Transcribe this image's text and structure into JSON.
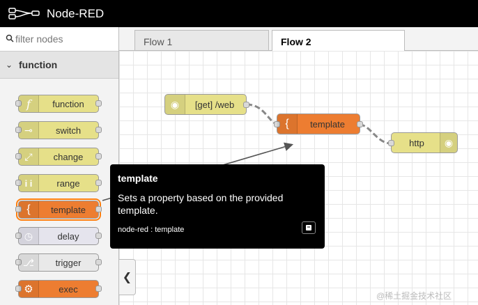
{
  "app": {
    "title": "Node-RED"
  },
  "palette": {
    "filter_placeholder": "filter nodes",
    "category": "function",
    "nodes": [
      {
        "label": "function",
        "icon": "function-icon",
        "color": "#e6e089"
      },
      {
        "label": "switch",
        "icon": "switch-icon",
        "color": "#e6e089"
      },
      {
        "label": "change",
        "icon": "change-icon",
        "color": "#e6e089"
      },
      {
        "label": "range",
        "icon": "range-icon",
        "color": "#e6e089"
      },
      {
        "label": "template",
        "icon": "template-icon",
        "color": "#ed7d31"
      },
      {
        "label": "delay",
        "icon": "delay-icon",
        "color": "#e5e4ed"
      },
      {
        "label": "trigger",
        "icon": "trigger-icon",
        "color": "#e9e9e9"
      },
      {
        "label": "exec",
        "icon": "gear-icon",
        "color": "#ed7d31"
      }
    ]
  },
  "tabs": [
    {
      "label": "Flow 1",
      "active": false
    },
    {
      "label": "Flow 2",
      "active": true
    }
  ],
  "flow": {
    "nodes": [
      {
        "label": "[get] /web",
        "icon": "globe-icon",
        "color": "#e6e089"
      },
      {
        "label": "template",
        "icon": "template-icon",
        "color": "#ed7d31"
      },
      {
        "label": "http",
        "icon": "globe-icon",
        "color": "#e6e089"
      }
    ]
  },
  "tooltip": {
    "title": "template",
    "body": "Sets a property based on the provided template.",
    "source": "node-red : template"
  },
  "watermark": "@稀土掘金技术社区"
}
